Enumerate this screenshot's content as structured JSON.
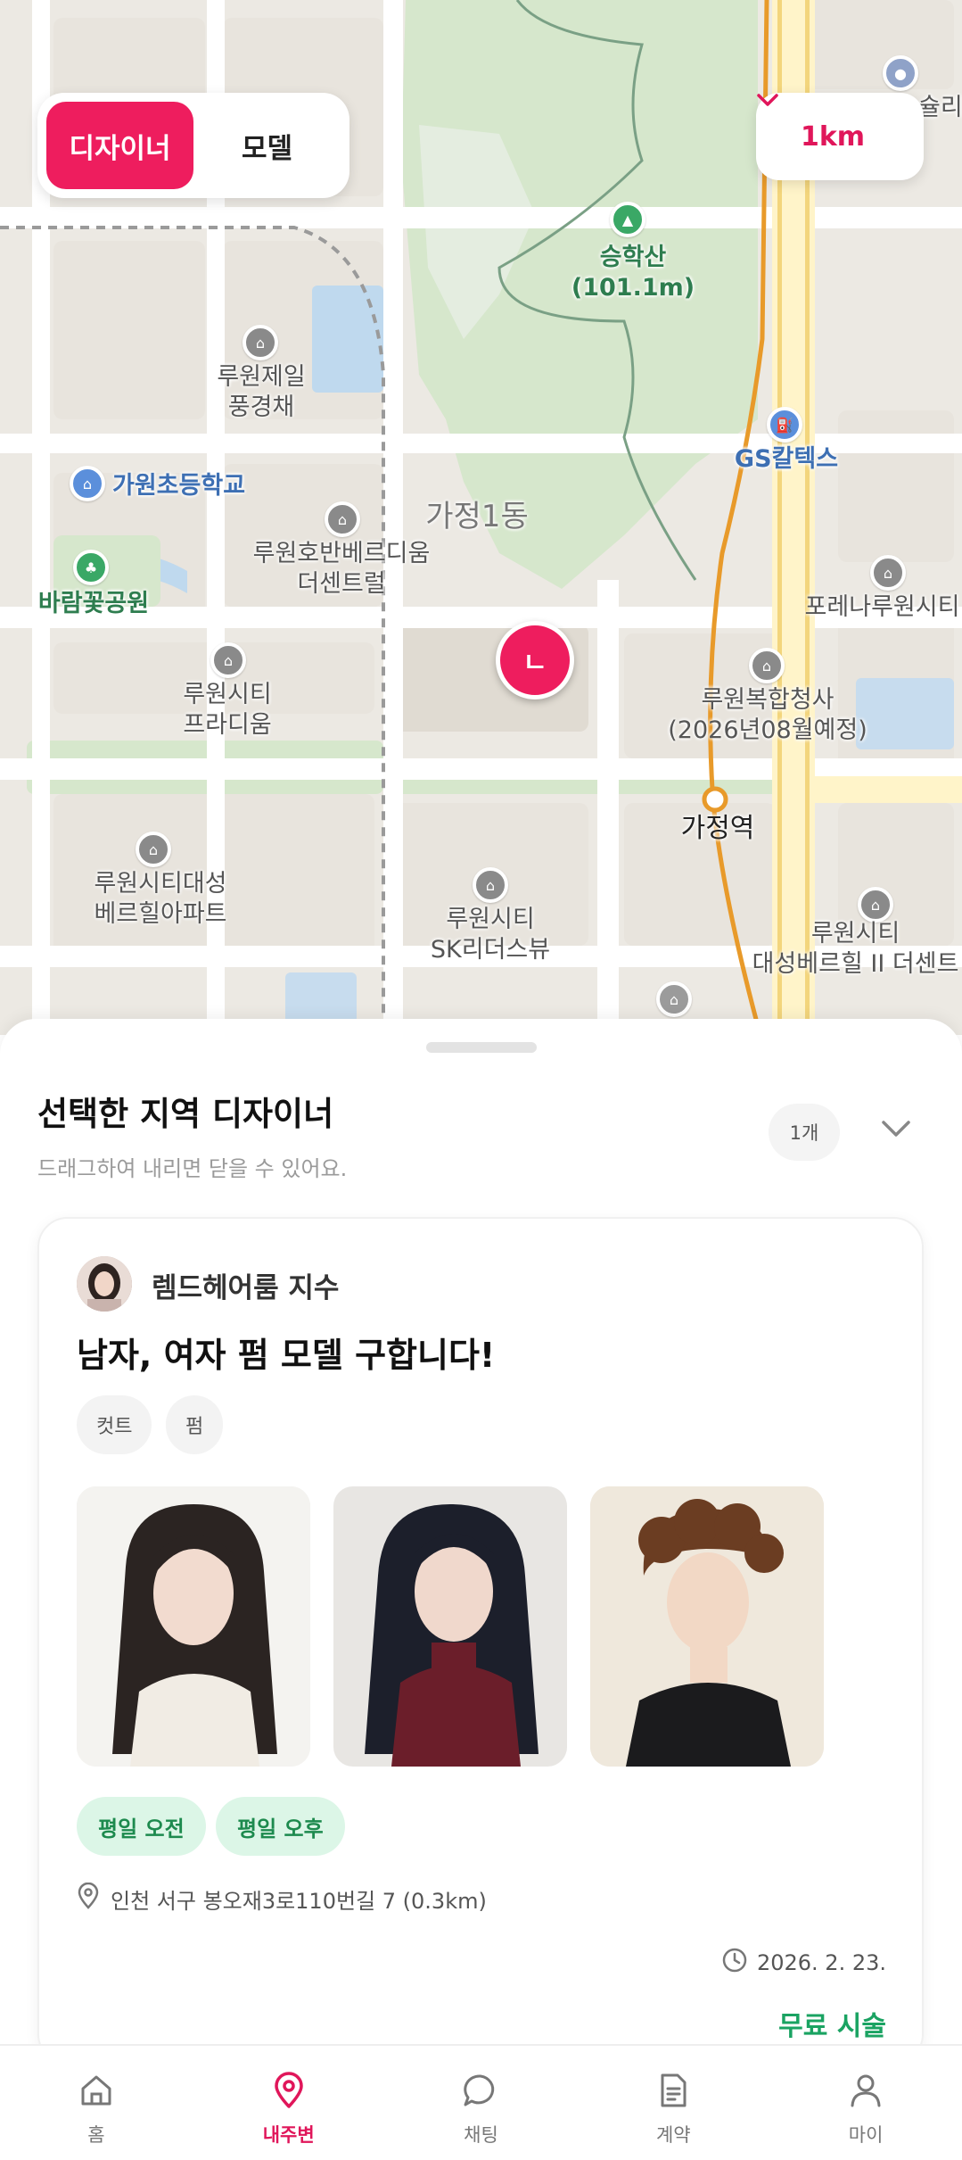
{
  "map": {
    "labels": {
      "seunghaksan": "승학산\n(101.1m)",
      "gs_caltex": "GS칼텍스",
      "ruwon_jeil": "루원제일\n풍경채",
      "gawon_school": "가원초등학교",
      "gajeong1dong": "가정1동",
      "ruwon_hoban": "루원호반베르디움\n더센트럴",
      "baramkkot_park": "바람꽃공원",
      "ruwon_city_paradium": "루원시티\n프라디움",
      "forena": "포레나루원시티",
      "ruwon_complex": "루원복합청사\n(2026년08월예정)",
      "gajeong_station": "가정역",
      "ruwon_daesung": "루원시티대성\n베르힐아파트",
      "ruwon_sk": "루원시티\nSK리더스뷰",
      "ruwon_daesung2": "루원시티\n대성베르힐 II 더센트",
      "top_right": "슐리"
    },
    "marker_label": "ㄴ",
    "colors": {
      "accent": "#ee1d5e",
      "road": "#ffffff",
      "park": "#d9ead2",
      "block": "#e6e1d8",
      "subway": "#e89a2a"
    }
  },
  "mode_toggle": {
    "designer_label": "디자이너",
    "model_label": "모델",
    "selected": "디자이너"
  },
  "distance": {
    "value": "1km",
    "icon": "chevron-down-icon"
  },
  "sheet": {
    "title": "선택한 지역 디자이너",
    "subtitle": "드래그하여 내리면 닫을 수 있어요.",
    "count": "1개"
  },
  "card": {
    "shop_name": "렘드헤어룸 지수",
    "title": "남자, 여자 펌 모델 구합니다!",
    "tags": [
      "컷트",
      "펌"
    ],
    "time_slots": [
      "평일 오전",
      "평일 오후"
    ],
    "address": "인천 서구 봉오재3로110번길 7 (0.3km)",
    "date": "2026. 2. 23.",
    "price": "무료 시술"
  },
  "nav": {
    "items": [
      {
        "label": "홈",
        "icon": "home-icon"
      },
      {
        "label": "내주변",
        "icon": "location-pin-icon"
      },
      {
        "label": "채팅",
        "icon": "chat-bubble-icon"
      },
      {
        "label": "계약",
        "icon": "document-icon"
      },
      {
        "label": "마이",
        "icon": "person-icon"
      }
    ],
    "active": "내주변"
  }
}
